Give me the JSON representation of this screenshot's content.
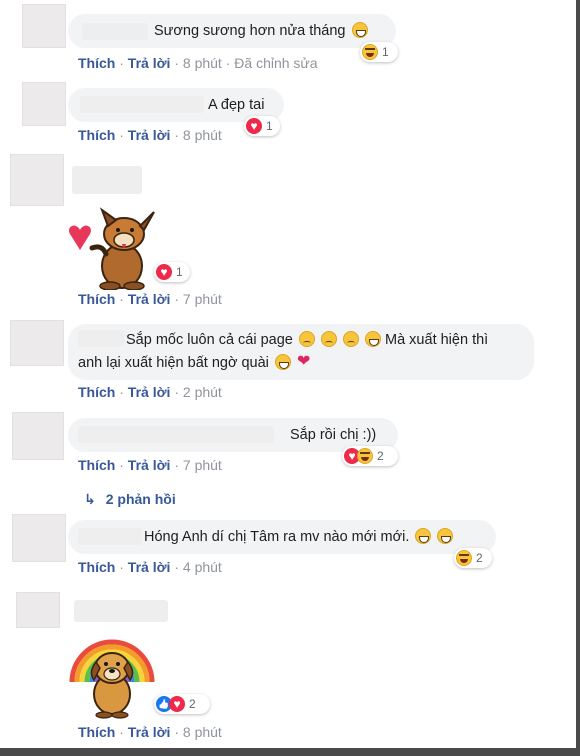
{
  "comments": [
    {
      "text": "Sương sương hơn nửa tháng",
      "actions": {
        "like": "Thích",
        "reply": "Trả lời",
        "time": "8 phút",
        "edited": "Đã chỉnh sửa"
      },
      "reaction_count": "1"
    },
    {
      "text": "A đẹp tai",
      "actions": {
        "like": "Thích",
        "reply": "Trả lời",
        "time": "8 phút"
      },
      "reaction_count": "1"
    },
    {
      "sticker": "dog-with-heart-sticker",
      "actions": {
        "like": "Thích",
        "reply": "Trả lời",
        "time": "7 phút"
      },
      "reaction_count": "1"
    },
    {
      "text_line1": "Sắp mốc luôn cả cái page",
      "text_line1_tail": "Mà xuất hiện thì",
      "text_line2": "anh lại xuất hiện bất ngờ quài",
      "actions": {
        "like": "Thích",
        "reply": "Trả lời",
        "time": "2 phút"
      }
    },
    {
      "text": "Sắp rồi chị :))",
      "actions": {
        "like": "Thích",
        "reply": "Trả lời",
        "time": "7 phút"
      },
      "reaction_count": "2",
      "replies_label": "2 phản hồi"
    },
    {
      "text": "Hóng Anh dí chị Tâm ra mv nào mới mới.",
      "actions": {
        "like": "Thích",
        "reply": "Trả lời",
        "time": "4 phút"
      },
      "reaction_count": "2"
    },
    {
      "sticker": "dog-with-rainbow-sticker",
      "actions": {
        "like": "Thích",
        "reply": "Trả lời",
        "time": "8 phút"
      },
      "reaction_count": "2"
    }
  ],
  "colors": {
    "link": "#385898",
    "meta": "#90949c",
    "bubble": "#f2f3f5"
  },
  "separator": "·"
}
